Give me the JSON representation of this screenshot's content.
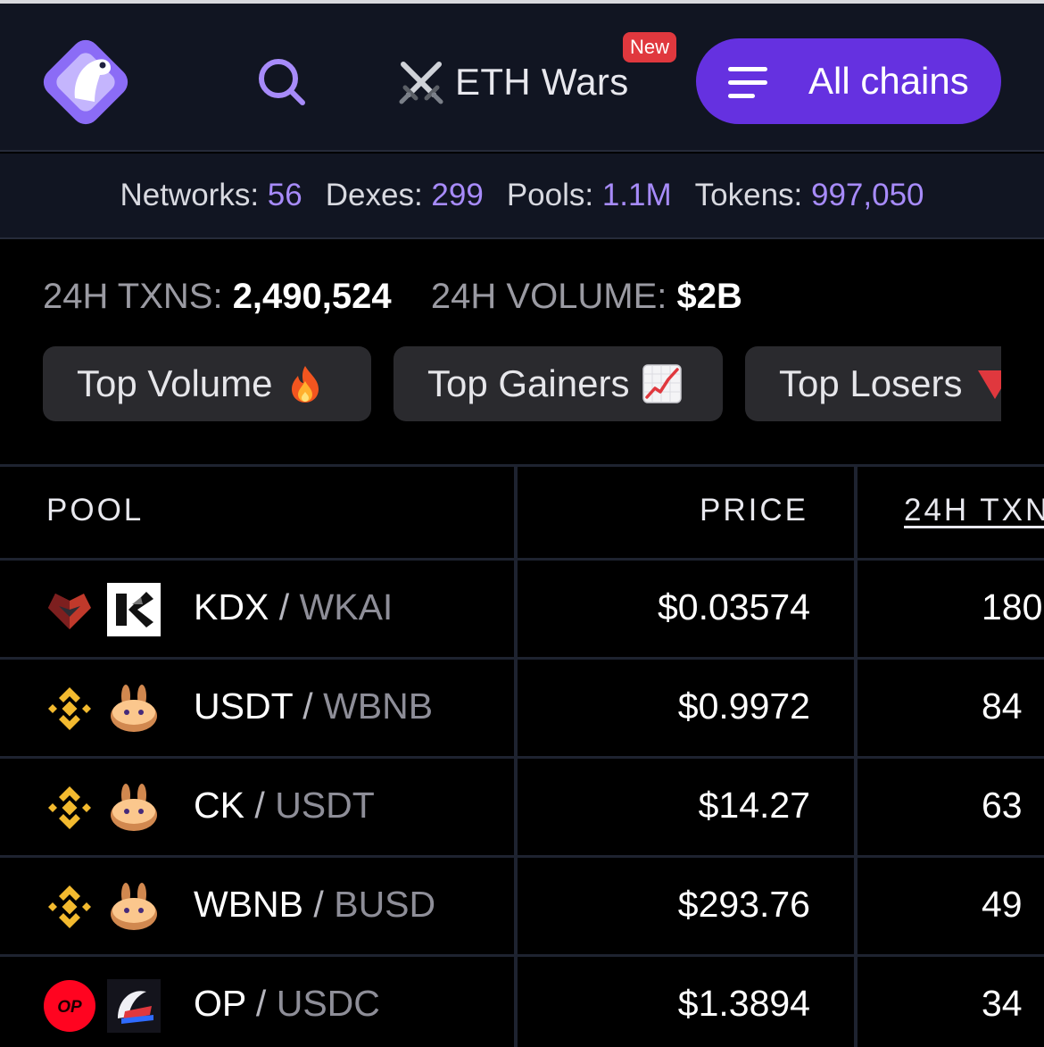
{
  "header": {
    "logo_name": "geckoterminal-logo",
    "search_icon": "search-icon",
    "promo": {
      "label": "ETH Wars",
      "badge": "New",
      "icon": "crossed-swords-icon"
    },
    "chains_button": {
      "label": "All chains",
      "icon": "menu-icon"
    }
  },
  "stats": {
    "networks_label": "Networks:",
    "networks_value": "56",
    "dexes_label": "Dexes:",
    "dexes_value": "299",
    "pools_label": "Pools:",
    "pools_value": "1.1M",
    "tokens_label": "Tokens:",
    "tokens_value": "997,050"
  },
  "summary": {
    "txns_label": "24H TXNS:",
    "txns_value": "2,490,524",
    "volume_label": "24H VOLUME:",
    "volume_value": "$2B"
  },
  "filters": [
    {
      "label": "Top Volume",
      "icon": "fire-icon"
    },
    {
      "label": "Top Gainers",
      "icon": "chart-up-icon"
    },
    {
      "label": "Top Losers",
      "icon": "red-triangle-down-icon"
    }
  ],
  "table": {
    "columns": {
      "pool": "POOL",
      "price": "PRICE",
      "txns": "24H TXN"
    },
    "rows": [
      {
        "base": "KDX",
        "sep": "/",
        "quote": "WKAI",
        "price": "$0.03574",
        "txns": "180",
        "icon1": "kdx-token-icon",
        "icon2": "kai-token-icon"
      },
      {
        "base": "USDT",
        "sep": "/",
        "quote": "WBNB",
        "price": "$0.9972",
        "txns": "84",
        "icon1": "bnb-chain-icon",
        "icon2": "pancakeswap-icon"
      },
      {
        "base": "CK",
        "sep": "/",
        "quote": "USDT",
        "price": "$14.27",
        "txns": "63",
        "icon1": "bnb-chain-icon",
        "icon2": "pancakeswap-icon"
      },
      {
        "base": "WBNB",
        "sep": "/",
        "quote": "BUSD",
        "price": "$293.76",
        "txns": "49",
        "icon1": "bnb-chain-icon",
        "icon2": "pancakeswap-icon"
      },
      {
        "base": "OP",
        "sep": "/",
        "quote": "USDC",
        "price": "$1.3894",
        "txns": "34",
        "icon1": "optimism-icon",
        "icon2": "velodrome-icon",
        "icon1_text": "OP"
      }
    ]
  },
  "colors": {
    "accent": "#6531e0",
    "stat_value": "#a78bfa",
    "header_bg": "#111522",
    "badge": "#e0383e"
  }
}
